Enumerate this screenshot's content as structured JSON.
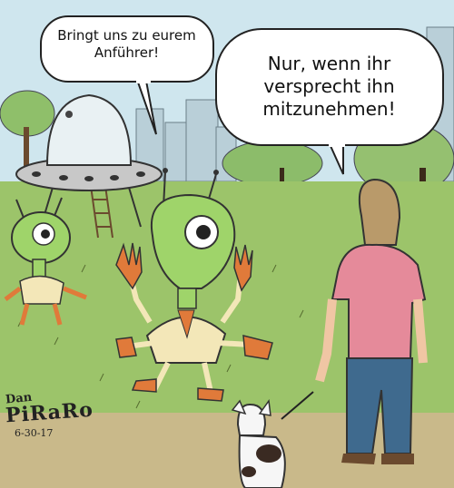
{
  "comic": {
    "speech_left": "Bringt uns zu eurem Anführer!",
    "speech_right": "Nur, wenn ihr versprecht ihn mitzunehmen!",
    "signature": {
      "name_top": "Dan",
      "name_main": "PiRaRo",
      "date": "6-30-17"
    }
  },
  "colors": {
    "sky": "#cfe6ee",
    "grass": "#9cc46a",
    "alien": "#9fd46a",
    "glove": "#e07a3a",
    "shirt": "#e58a9a",
    "jeans": "#3f6a8e",
    "ufo": "#c8c8c8"
  }
}
